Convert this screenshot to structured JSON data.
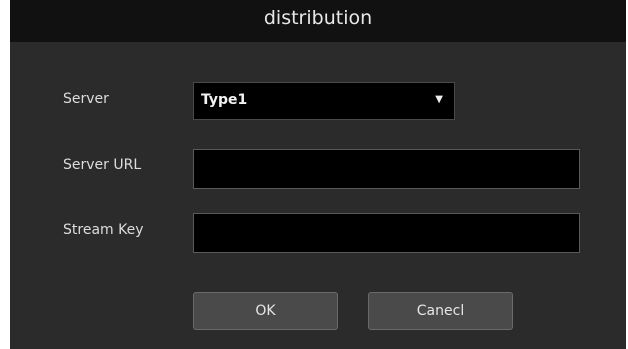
{
  "dialog": {
    "title": "distribution"
  },
  "form": {
    "server_label": "Server",
    "server_value": "Type1",
    "server_url_label": "Server URL",
    "server_url_value": "",
    "stream_key_label": "Stream Key",
    "stream_key_value": ""
  },
  "buttons": {
    "ok_label": "OK",
    "cancel_label": "Canecl"
  },
  "icons": {
    "dropdown": "chevron-down-icon"
  },
  "colors": {
    "dialog_bg": "#2b2b2b",
    "titlebar_bg": "#111111",
    "input_bg": "#000000",
    "button_bg": "#4a4a4a"
  }
}
